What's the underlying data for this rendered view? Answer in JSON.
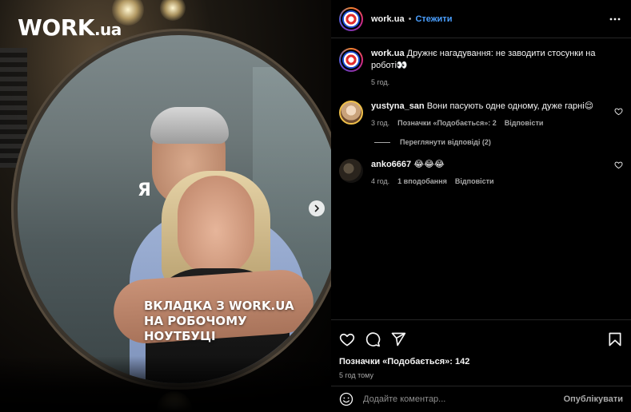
{
  "media": {
    "logo_main": "WORK",
    "logo_tld": ".ua",
    "ya_label": "Я",
    "overlay_line1": "ВКЛАДКА З WORK.UA",
    "overlay_line2": "НА РОБОЧОМУ НОУТБУЦІ",
    "next_icon": "chevron-right-icon"
  },
  "header": {
    "username": "work.ua",
    "separator": "•",
    "follow_label": "Стежити",
    "more_icon": "more-horizontal-icon"
  },
  "caption": {
    "username": "work.ua",
    "text": "Дружнє нагадування: не заводити стосунки на роботі👀",
    "time": "5 год."
  },
  "comments": [
    {
      "username": "yustyna_san",
      "text": "Вони пасують одне одному, дуже гарні😌",
      "time": "3 год.",
      "likes": "Позначки «Подобається»: 2",
      "reply": "Відповісти",
      "view_replies": "Переглянути відповіді (2)"
    },
    {
      "username": "anko6667",
      "text": "😂😂😂",
      "time": "4 год.",
      "likes": "1 вподобання",
      "reply": "Відповісти"
    }
  ],
  "actions": {
    "likes_text": "Позначки «Подобається»: 142",
    "time_ago": "5 год тому"
  },
  "add_comment": {
    "placeholder": "Додайте коментар...",
    "publish_label": "Опублікувати"
  },
  "colors": {
    "accent_link": "#4a9fff",
    "background": "#000000",
    "text_secondary": "#a8a8a8"
  }
}
